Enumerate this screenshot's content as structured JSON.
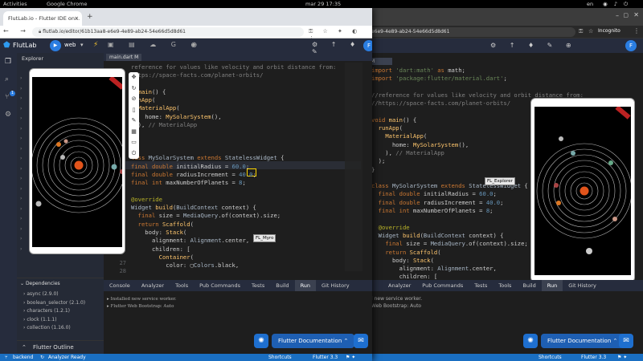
{
  "system_bar": {
    "activities": "Activities",
    "app": "Google Chrome",
    "clock": "mar 29  17:35",
    "lang": "en"
  },
  "browser": {
    "tab_title": "FlutLab.io - Flutter IDE on...",
    "url": "flutlab.io/editor/61b13aa8-e6e9-4e89-ab24-54e66d5d8d61",
    "url_right": "d-e6e9-4e89-ab24-54e66d5d8d61",
    "incognito": "Incognito"
  },
  "flutlab": {
    "logo": "FlutLab",
    "platform": "web",
    "explorer_title": "Explorer",
    "file_tab": "main.dart M",
    "file_tab_right": "M",
    "dependencies_title": "Dependencies",
    "dependencies": [
      "async (2.9.0)",
      "boolean_selector (2.1.0)",
      "characters (1.2.1)",
      "clock (1.1.1)",
      "collection (1.16.0)"
    ],
    "outline": "Flutter Outline",
    "tooltip_myro": "FL_Myro",
    "tooltip_explorer": "FL_Explorer",
    "bottom_tabs": [
      "Console",
      "Analyzer",
      "Tools",
      "Pub Commands",
      "Tests",
      "Build",
      "Run",
      "Git History"
    ],
    "bottom_tabs_right": [
      "Analyzer",
      "Pub Commands",
      "Tests",
      "Tools",
      "Build",
      "Run",
      "Git History"
    ],
    "console": [
      "Installed new service worker.",
      "Flutter Web Bootstrap: Auto"
    ],
    "console_right": [
      "l new service worker.",
      "Web Bootstrap: Auto"
    ],
    "doc_button": "Flutter Documentation",
    "status_branch": "backend",
    "status_analyzer": "Analyzer Ready",
    "status_shortcuts": "Shortcuts",
    "status_flutter": "Flutter 3.3",
    "badge_count": "1",
    "debug_banner": "DEBUG"
  },
  "code_left": {
    "line_numbers": [
      "27",
      "28"
    ]
  },
  "colors": {
    "accent": "#1e6fcf",
    "status": "#1a6fc2",
    "editor_bg": "#1e1e1e",
    "toolbar": "#262c3d"
  }
}
